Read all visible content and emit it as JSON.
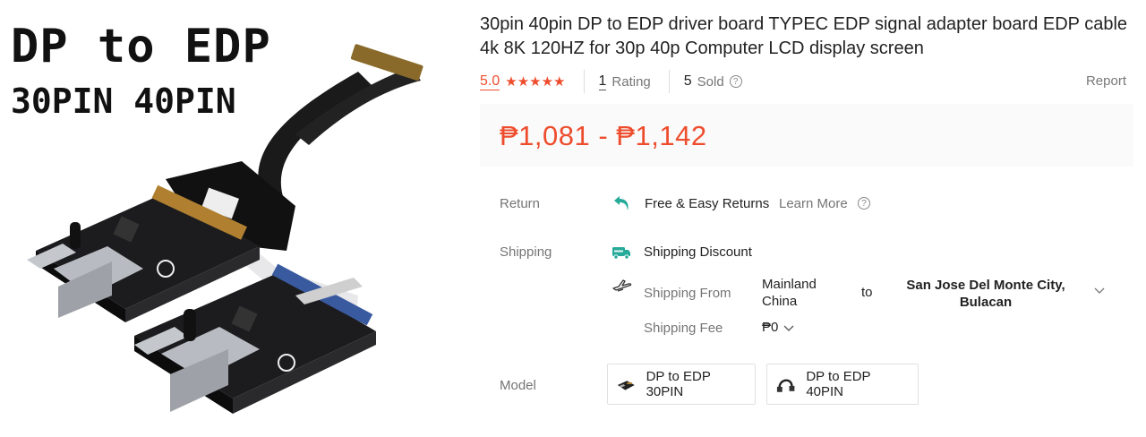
{
  "image": {
    "title_line1": "DP to EDP",
    "title_line2": "30PIN 40PIN"
  },
  "product": {
    "title": "30pin 40pin DP to EDP driver board TYPEC EDP signal adapter board EDP cable 4k 8K 120HZ for 30p 40p Computer LCD display screen",
    "rating_score": "5.0",
    "stars": 5,
    "ratings_count": "1",
    "ratings_label": "Rating",
    "sold_count": "5",
    "sold_label": "Sold",
    "report_label": "Report",
    "price": "₱1,081 - ₱1,142",
    "accent_color": "#ee4d2d"
  },
  "return": {
    "label": "Return",
    "text": "Free & Easy Returns",
    "learn_more": "Learn More",
    "icon": "return-arrow-icon"
  },
  "shipping": {
    "label": "Shipping",
    "discount_text": "Shipping Discount",
    "from_label": "Shipping From",
    "origin": "Mainland China",
    "to_word": "to",
    "destination": "San Jose Del Monte City, Bulacan",
    "fee_label": "Shipping Fee",
    "fee_value": "₱0",
    "icons": [
      "free-shipping-truck-icon",
      "plane-icon",
      "chevron-down-icon"
    ]
  },
  "model": {
    "label": "Model",
    "options": [
      {
        "label": "DP to EDP 30PIN"
      },
      {
        "label": "DP to EDP 40PIN"
      }
    ]
  }
}
